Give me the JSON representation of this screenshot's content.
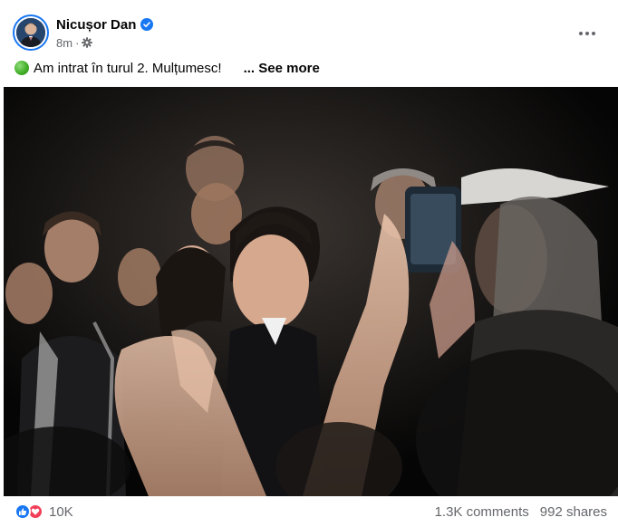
{
  "post": {
    "author_name": "Nicușor Dan",
    "timestamp": "8m",
    "meta_separator": "·",
    "text": "Am intrat în turul 2. Mulțumesc!",
    "see_more_label": "... See more"
  },
  "footer": {
    "reaction_count": "10K",
    "comments_label": "1.3K comments",
    "shares_label": "992 shares"
  },
  "colors": {
    "brand_blue": "#1877f2",
    "love_red": "#f33e58",
    "secondary_text": "#65676b"
  },
  "icons": [
    "verified-icon",
    "gear-icon",
    "more-icon",
    "green-circle-emoji",
    "like-icon",
    "love-icon"
  ]
}
